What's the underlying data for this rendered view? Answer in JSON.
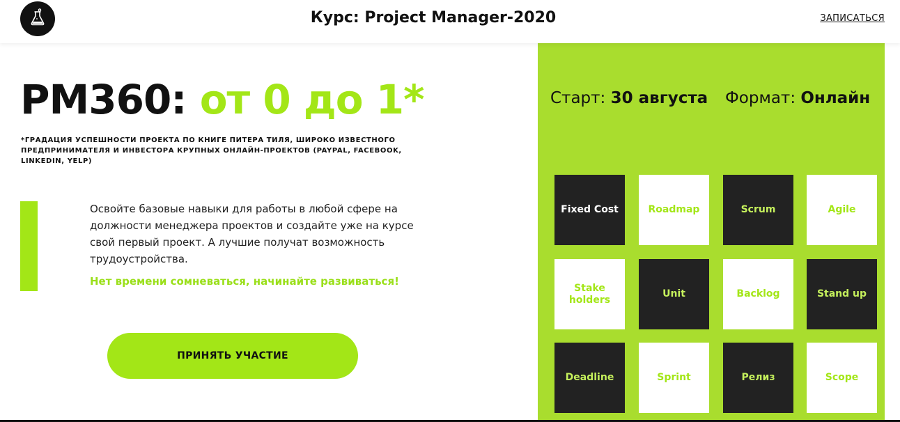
{
  "header": {
    "title": "Курс: Project Manager-2020",
    "enroll_label": "ЗАПИСАТЬСЯ",
    "logo_icon": "flask-icon"
  },
  "hero": {
    "headline_main": "PM360: ",
    "headline_accent": "от 0 до 1*",
    "footnote": "*Градация успешности проекта по книге Питера Тиля, широко известного предпринимателя и инвестора крупных онлайн-проектов (PayPal, Facebook, LinkedIn, Yelp)",
    "description": "Освойте базовые навыки для работы в любой сфере на должности менеджера проектов и создайте уже на курсе свой первый проект. А лучшие получат возможность трудоустройства.",
    "cta_text": "Нет времени сомневаться, начинайте развиваться!",
    "join_button": "ПРИНЯТЬ УЧАСТИЕ"
  },
  "panel": {
    "start_label": "Старт: ",
    "start_value": "30 августа",
    "format_label": "Формат: ",
    "format_value": "Онлайн",
    "tiles": [
      {
        "label": "Fixed Cost",
        "style": "dark-white"
      },
      {
        "label": "Roadmap",
        "style": "light"
      },
      {
        "label": "Scrum",
        "style": "dark-green"
      },
      {
        "label": "Agile",
        "style": "light"
      },
      {
        "label": "Stake holders",
        "style": "light"
      },
      {
        "label": "Unit",
        "style": "dark-green"
      },
      {
        "label": "Backlog",
        "style": "light"
      },
      {
        "label": "Stand up",
        "style": "dark-green"
      },
      {
        "label": "Deadline",
        "style": "dark-green"
      },
      {
        "label": "Sprint",
        "style": "light"
      },
      {
        "label": "Релиз",
        "style": "dark-green"
      },
      {
        "label": "Scope",
        "style": "light"
      }
    ]
  },
  "colors": {
    "accent": "#a3e617",
    "panel": "#a9dd2e",
    "tile_dark": "#222222"
  }
}
